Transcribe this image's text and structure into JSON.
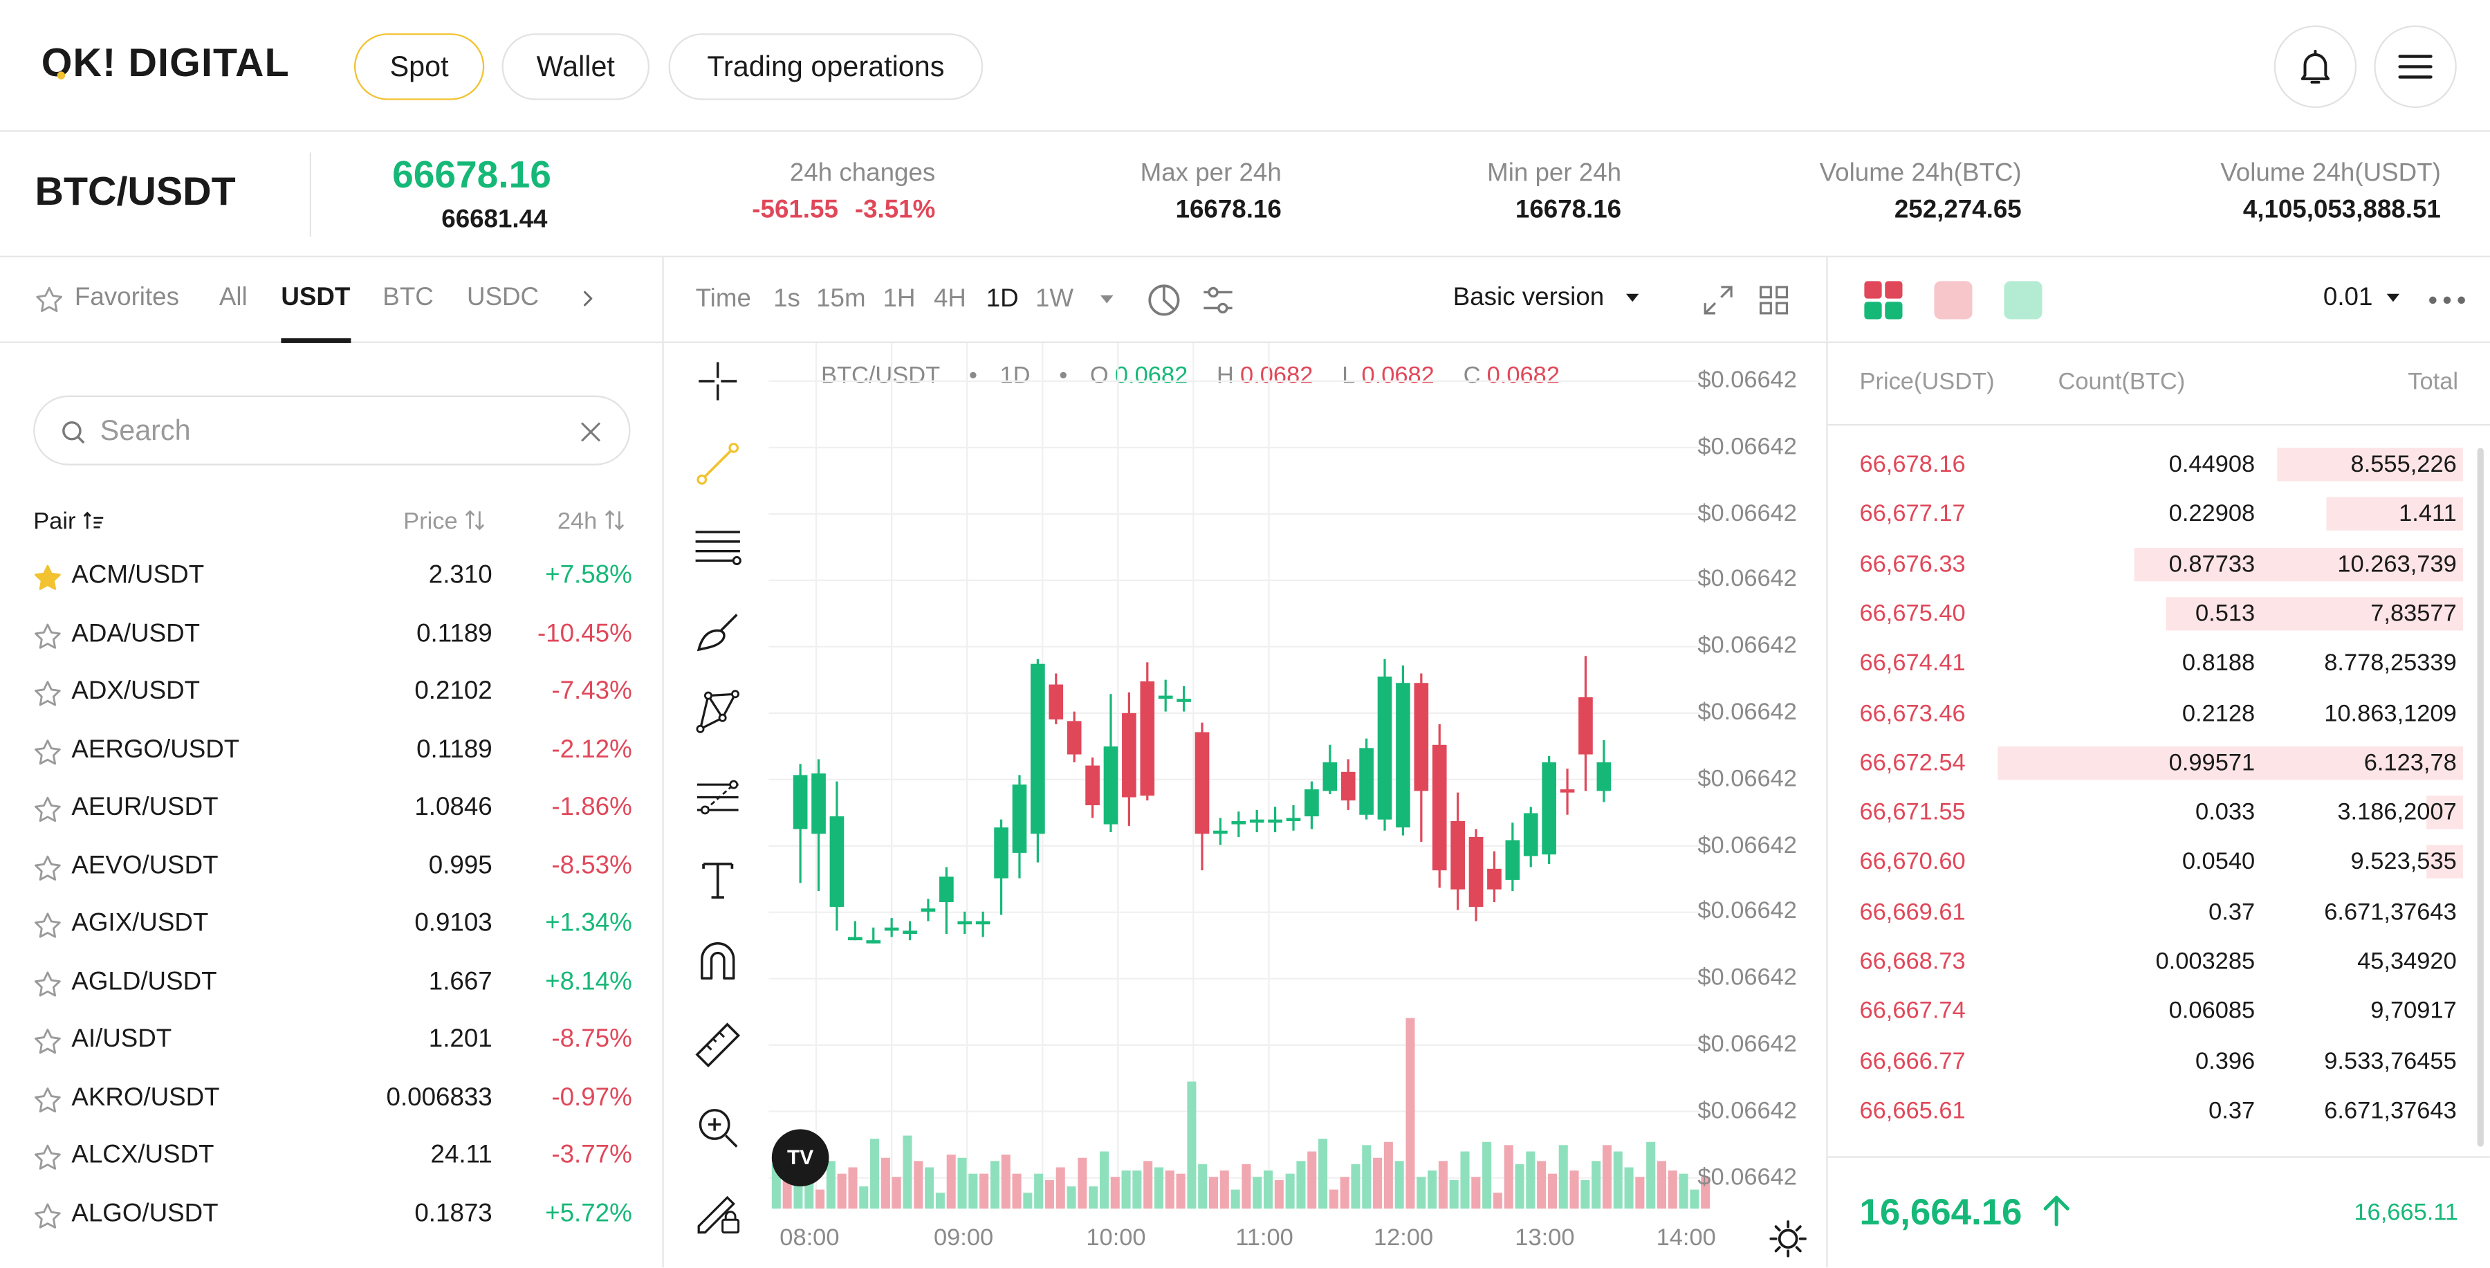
{
  "brand": {
    "logo_text": "OK! DIGITAL"
  },
  "nav": {
    "spot": "Spot",
    "wallet": "Wallet",
    "trading": "Trading operations"
  },
  "ticker": {
    "pair": "BTC/USDT",
    "last_price": "66678.16",
    "last_sub": "66681.44",
    "changes_label": "24h changes",
    "changes_abs": "-561.55",
    "changes_pct": "-3.51%",
    "max_label": "Max per 24h",
    "max_value": "16678.16",
    "min_label": "Min per 24h",
    "min_value": "16678.16",
    "vol_btc_label": "Volume 24h(BTC)",
    "vol_btc_value": "252,274.65",
    "vol_usdt_label": "Volume 24h(USDT)",
    "vol_usdt_value": "4,105,053,888.51"
  },
  "markets": {
    "tabs": {
      "favorites": "Favorites",
      "all": "All",
      "usdt": "USDT",
      "btc": "BTC",
      "usdc": "USDC"
    },
    "search_placeholder": "Search",
    "col_pair": "Pair",
    "col_price": "Price",
    "col_24h": "24h",
    "rows": [
      {
        "pair": "ACM/USDT",
        "price": "2.310",
        "change": "+7.58%",
        "up": true,
        "fav": true
      },
      {
        "pair": "ADA/USDT",
        "price": "0.1189",
        "change": "-10.45%",
        "up": false,
        "fav": false
      },
      {
        "pair": "ADX/USDT",
        "price": "0.2102",
        "change": "-7.43%",
        "up": false,
        "fav": false
      },
      {
        "pair": "AERGO/USDT",
        "price": "0.1189",
        "change": "-2.12%",
        "up": false,
        "fav": false
      },
      {
        "pair": "AEUR/USDT",
        "price": "1.0846",
        "change": "-1.86%",
        "up": false,
        "fav": false
      },
      {
        "pair": "AEVO/USDT",
        "price": "0.995",
        "change": "-8.53%",
        "up": false,
        "fav": false
      },
      {
        "pair": "AGIX/USDT",
        "price": "0.9103",
        "change": "+1.34%",
        "up": true,
        "fav": false
      },
      {
        "pair": "AGLD/USDT",
        "price": "1.667",
        "change": "+8.14%",
        "up": true,
        "fav": false
      },
      {
        "pair": "AI/USDT",
        "price": "1.201",
        "change": "-8.75%",
        "up": false,
        "fav": false
      },
      {
        "pair": "AKRO/USDT",
        "price": "0.006833",
        "change": "-0.97%",
        "up": false,
        "fav": false
      },
      {
        "pair": "ALCX/USDT",
        "price": "24.11",
        "change": "-3.77%",
        "up": false,
        "fav": false
      },
      {
        "pair": "ALGO/USDT",
        "price": "0.1873",
        "change": "+5.72%",
        "up": true,
        "fav": false
      }
    ]
  },
  "chart": {
    "toolbar": {
      "time": "Time",
      "tf": [
        "1s",
        "15m",
        "1H",
        "4H",
        "1D",
        "1W"
      ],
      "active_tf": "1D",
      "version": "Basic version"
    },
    "legend": {
      "pair": "BTC/USDT",
      "interval": "1D",
      "o_label": "O",
      "o": "0.0682",
      "h_label": "H",
      "h": "0.0682",
      "l_label": "L",
      "l": "0.0682",
      "c_label": "C",
      "c": "0.0682"
    },
    "y_labels": [
      "$0.06642",
      "$0.06642",
      "$0.06642",
      "$0.06642",
      "$0.06642",
      "$0.06642",
      "$0.06642",
      "$0.06642",
      "$0.06642",
      "$0.06642",
      "$0.06642",
      "$0.06642",
      "$0.06642"
    ],
    "x_labels": [
      "08:00",
      "09:00",
      "10:00",
      "11:00",
      "12:00",
      "13:00",
      "14:00"
    ],
    "tv_logo": "TV",
    "colors": {
      "up": "#16b878",
      "down": "#e0485a",
      "vol_up": "#8ee0bd",
      "vol_down": "#f1a7b0"
    }
  },
  "orderbook": {
    "precision": "0.01",
    "col_price": "Price(USDT)",
    "col_count": "Count(BTC)",
    "col_total": "Total",
    "asks": [
      {
        "price": "66,678.16",
        "count": "0.44908",
        "total": "8.555,226",
        "depth": 0.3
      },
      {
        "price": "66,677.17",
        "count": "0.22908",
        "total": "1.411",
        "depth": 0.22
      },
      {
        "price": "66,676.33",
        "count": "0.87733",
        "total": "10.263,739",
        "depth": 0.53
      },
      {
        "price": "66,675.40",
        "count": "0.513",
        "total": "7,83577",
        "depth": 0.48
      },
      {
        "price": "66,674.41",
        "count": "0.8188",
        "total": "8.778,25339",
        "depth": 0
      },
      {
        "price": "66,673.46",
        "count": "0.2128",
        "total": "10.863,1209",
        "depth": 0
      },
      {
        "price": "66,672.54",
        "count": "0.99571",
        "total": "6.123,78",
        "depth": 0.75
      },
      {
        "price": "66,671.55",
        "count": "0.033",
        "total": "3.186,2007",
        "depth": 0.06
      },
      {
        "price": "66,670.60",
        "count": "0.0540",
        "total": "9.523,535",
        "depth": 0.06
      },
      {
        "price": "66,669.61",
        "count": "0.37",
        "total": "6.671,37643",
        "depth": 0
      },
      {
        "price": "66,668.73",
        "count": "0.003285",
        "total": "45,34920",
        "depth": 0
      },
      {
        "price": "66,667.74",
        "count": "0.06085",
        "total": "9,70917",
        "depth": 0
      },
      {
        "price": "66,666.77",
        "count": "0.396",
        "total": "9.533,76455",
        "depth": 0
      },
      {
        "price": "66,665.61",
        "count": "0.37",
        "total": "6.671,37643",
        "depth": 0
      }
    ],
    "last_price": "16,664.16",
    "last_right": "16,665.11"
  }
}
